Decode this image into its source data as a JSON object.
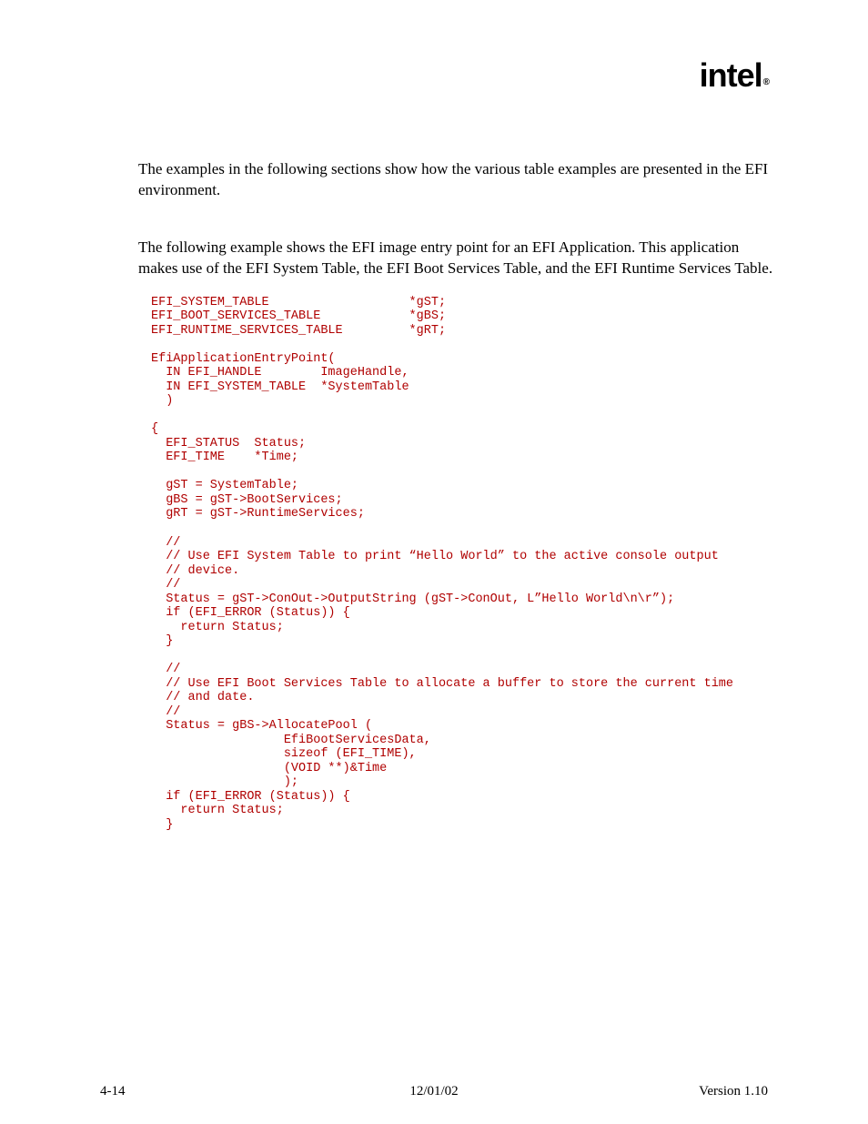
{
  "logo": {
    "text": "intel",
    "sub": "®"
  },
  "paragraphs": {
    "p1": "The examples in the following sections show how the various table examples are presented in the EFI environment.",
    "p2": "The following example shows the EFI image entry point for an EFI Application.  This application makes use of the EFI System Table, the EFI Boot Services Table, and the EFI Runtime Services Table."
  },
  "code": "EFI_SYSTEM_TABLE                   *gST;\nEFI_BOOT_SERVICES_TABLE            *gBS;\nEFI_RUNTIME_SERVICES_TABLE         *gRT;\n\nEfiApplicationEntryPoint(\n  IN EFI_HANDLE        ImageHandle,\n  IN EFI_SYSTEM_TABLE  *SystemTable\n  )\n\n{\n  EFI_STATUS  Status;\n  EFI_TIME    *Time;\n\n  gST = SystemTable;\n  gBS = gST->BootServices;\n  gRT = gST->RuntimeServices;\n\n  //\n  // Use EFI System Table to print “Hello World” to the active console output\n  // device.\n  //\n  Status = gST->ConOut->OutputString (gST->ConOut, L”Hello World\\n\\r”);\n  if (EFI_ERROR (Status)) {\n    return Status;\n  }\n\n  //\n  // Use EFI Boot Services Table to allocate a buffer to store the current time\n  // and date.\n  //\n  Status = gBS->AllocatePool (\n                  EfiBootServicesData,\n                  sizeof (EFI_TIME),\n                  (VOID **)&Time\n                  );\n  if (EFI_ERROR (Status)) {\n    return Status;\n  }",
  "footer": {
    "page": "4-14",
    "date": "12/01/02",
    "version": "Version 1.10"
  }
}
